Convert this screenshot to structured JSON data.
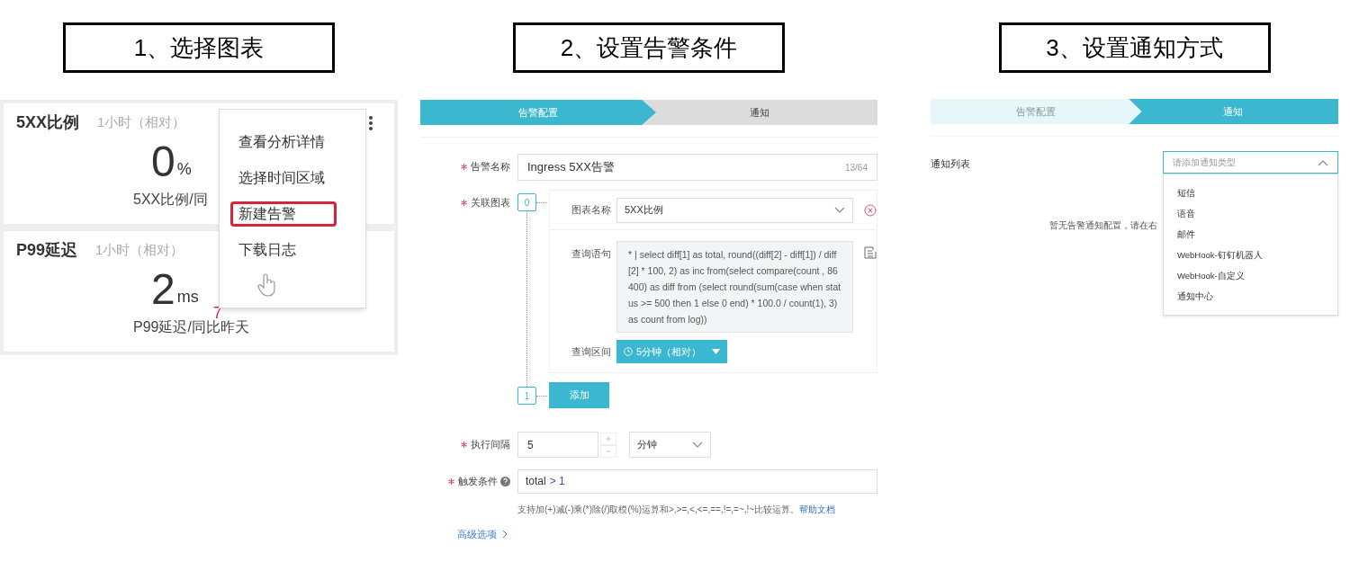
{
  "step_1": {
    "heading": "1、选择图表",
    "cards": [
      {
        "title": "5XX比例",
        "range": "1小时（相对）",
        "value": "0",
        "unit": "%",
        "caption": "5XX比例/同",
        "has_more": true
      },
      {
        "title": "P99延迟",
        "range": "1小时（相对）",
        "value": "2",
        "unit": "ms",
        "change": "7",
        "caption": "P99延迟/同比昨天",
        "has_more": false
      }
    ],
    "menu": [
      {
        "label": "查看分析详情",
        "highlighted": false
      },
      {
        "label": "选择时间区域",
        "highlighted": false
      },
      {
        "label": "新建告警",
        "highlighted": true
      },
      {
        "label": "下载日志",
        "highlighted": false
      }
    ]
  },
  "step_2": {
    "heading": "2、设置告警条件",
    "steps": [
      {
        "label": "告警配置",
        "selected": true
      },
      {
        "label": "通知",
        "selected": false
      }
    ],
    "name_field": {
      "label": "告警名称",
      "required": true,
      "value": "Ingress 5XX告警",
      "counter": "13/64"
    },
    "charts_field": {
      "label": "关联图表",
      "required": true
    },
    "charts": [
      {
        "index": "0",
        "name_label": "图表名称",
        "name": "5XX比例",
        "query_label": "查询语句",
        "query": "* | select diff[1] as total, round((diff[2] - diff[1]) / diff[2] * 100, 2) as inc from(select compare(count , 86400) as diff from (select round(sum(case when status >= 500 then 1 else 0 end) * 100.0 / count(1), 3) as count from log))",
        "range_label": "查询区间",
        "range": "5分钟（相对）"
      }
    ],
    "add": {
      "index": "1",
      "button": "添加"
    },
    "interval": {
      "label": "执行间隔",
      "required": true,
      "value": "5",
      "unit": "分钟"
    },
    "trigger": {
      "label": "触发条件",
      "required": true,
      "field": "total",
      "operator": "> 1",
      "hint": "支持加(+)减(-)乘(*)除(/)取模(%)运算和>,>=,<,<=,==,!=,=~,!~比较运算。",
      "help_link": "帮助文档"
    },
    "advanced": "高级选项"
  },
  "step_3": {
    "heading": "3、设置通知方式",
    "steps": [
      {
        "label": "告警配置",
        "selected": false
      },
      {
        "label": "通知",
        "selected": true
      }
    ],
    "list_label": "通知列表",
    "select": {
      "placeholder": "请添加通知类型",
      "expanded": true
    },
    "options": [
      "短信",
      "语音",
      "邮件",
      "WebHook-钉钉机器人",
      "WebHook-自定义",
      "通知中心"
    ],
    "empty_text": "暂无告警通知配置，请在右"
  }
}
